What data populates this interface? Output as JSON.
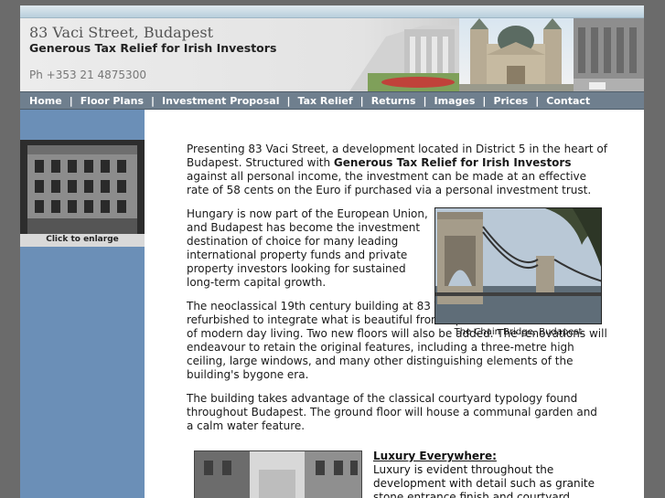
{
  "header": {
    "title": "83 Vaci Street, Budapest",
    "subtitle": "Generous Tax Relief for Irish Investors",
    "phone": "Ph +353 21 4875300"
  },
  "nav": {
    "items": [
      "Home",
      "Floor Plans",
      "Investment Proposal",
      "Tax Relief",
      "Returns",
      "Images",
      "Prices",
      "Contact"
    ],
    "separator": "|"
  },
  "sidebar": {
    "caption": "Click to enlarge"
  },
  "main": {
    "p1_start": "Presenting 83 Vaci Street, a development located in District 5 in the heart of Budapest. Structured with ",
    "p1_bold": "Generous Tax Relief for Irish Investors",
    "p1_end": " against all personal income, the investment can be made at an effective rate of 58 cents on the Euro if purchased via a personal investment trust.",
    "p2": "Hungary is now part of the European Union, and Budapest has become the investment destination of choice for many leading international property funds and private property investors looking for sustained long-term capital growth.",
    "p3": "The neoclassical 19th century building at 83 Vaci Street will be totally refurbished to integrate what is beautiful from a past era with the luxuries of modern day living. Two new floors will also be added. The renovations will endeavour to retain the original features, including a three-metre high ceiling, large windows, and many other distinguishing elements of the building's bygone era.",
    "p4": "The building takes advantage of the classical courtyard typology found throughout Budapest. The ground floor will house a communal garden and a calm water feature.",
    "figure_caption": "The Chain Bridge, Budapest",
    "luxury_heading": "Luxury Everywhere:",
    "luxury_text": "Luxury is evident throughout the development with detail such as granite stone entrance finish and courtyard"
  },
  "colors": {
    "background": "#6b6b6b",
    "nav": "#6f7f8e",
    "sidebar": "#6b8fb7"
  }
}
